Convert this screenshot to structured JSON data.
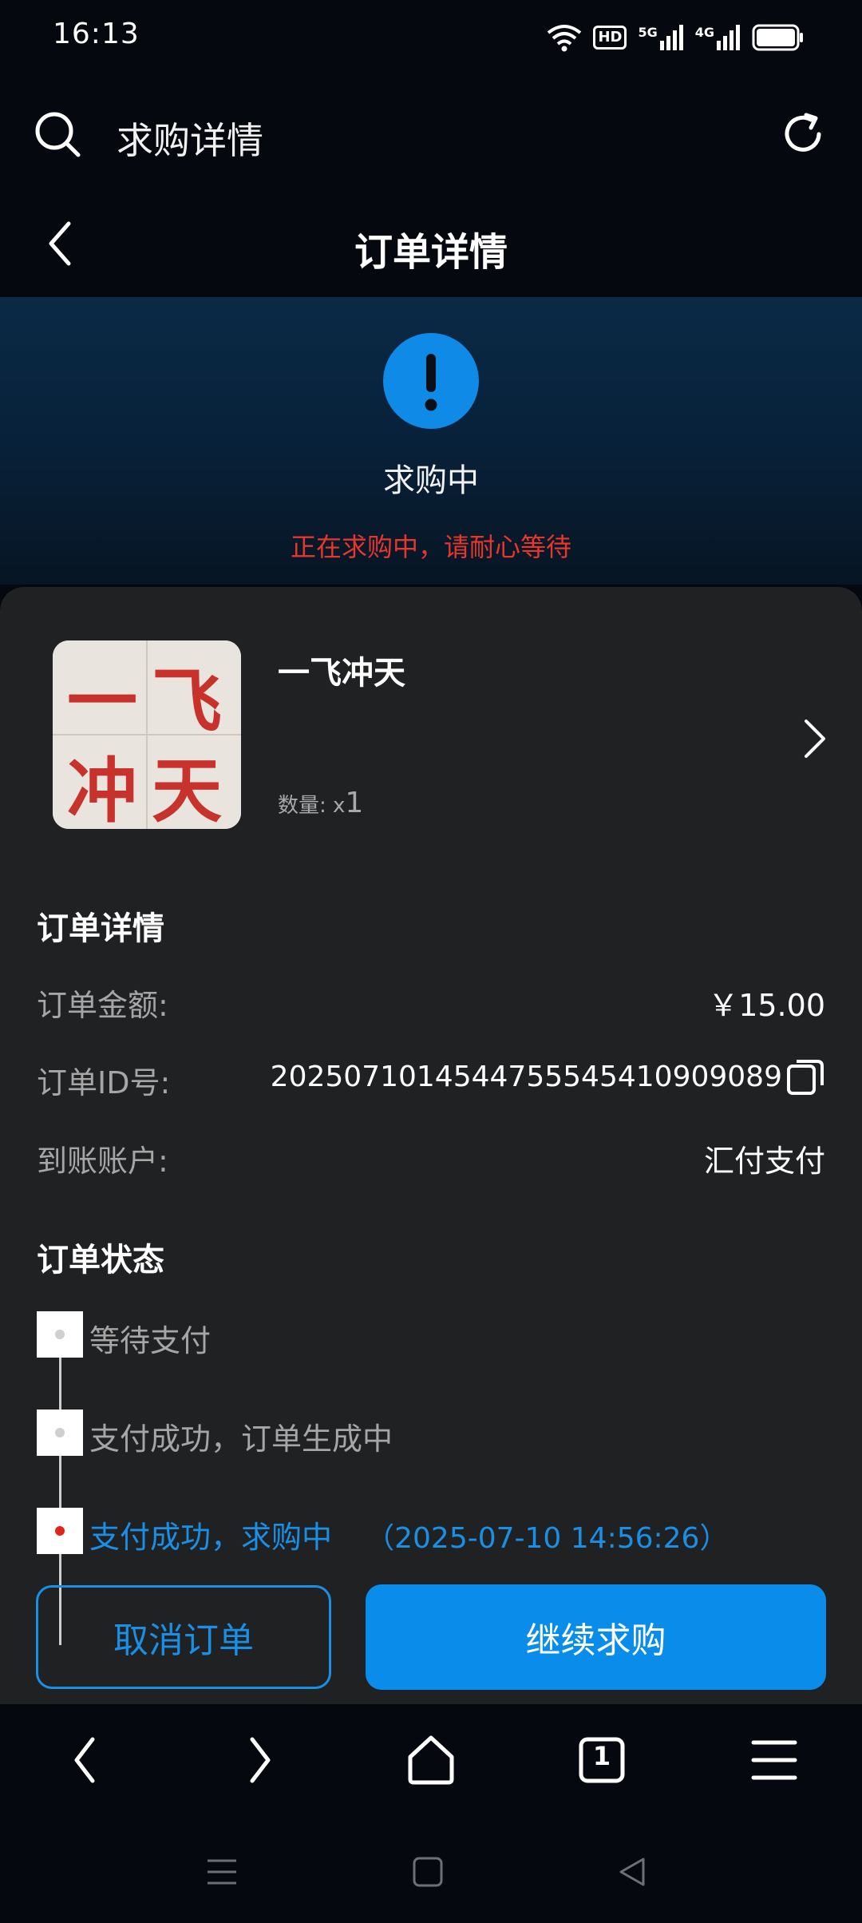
{
  "status_bar": {
    "time": "16:13",
    "network_1": "5G",
    "network_2": "4G",
    "hd_badge": "HD"
  },
  "browser": {
    "title": "求购详情"
  },
  "header": {
    "title": "订单详情"
  },
  "banner": {
    "status": "求购中",
    "message": "正在求购中，请耐心等待"
  },
  "product": {
    "name": "一飞冲天",
    "image_chars": [
      "一",
      "飞",
      "冲",
      "天"
    ],
    "qty_label": "数量:",
    "qty_prefix": "x",
    "qty_value": "1"
  },
  "order_details": {
    "title": "订单详情",
    "rows": [
      {
        "label": "订单金额:",
        "value": "￥15.00"
      },
      {
        "label": "订单ID号:",
        "value": "2025071014544755545410909089"
      },
      {
        "label": "到账账户:",
        "value": "汇付支付"
      }
    ]
  },
  "order_status": {
    "title": "订单状态",
    "steps": [
      {
        "text": "等待支付"
      },
      {
        "text": "支付成功，订单生成中"
      },
      {
        "text": "支付成功，求购中",
        "time": "（2025-07-10 14:56:26）",
        "active": true
      }
    ]
  },
  "actions": {
    "cancel": "取消订单",
    "continue": "继续求购"
  },
  "nav": {
    "tab_count": "1"
  },
  "colors": {
    "accent": "#0a8ceb",
    "warning": "#e8362d",
    "card_bg": "#202123",
    "page_bg": "#05080f"
  }
}
